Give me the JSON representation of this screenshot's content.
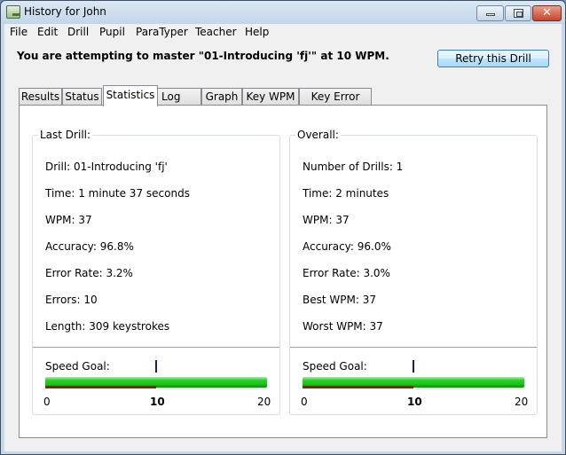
{
  "window": {
    "title": "History for John",
    "controls": {
      "minimize": "minimize",
      "maximize": "maximize",
      "close": "close"
    }
  },
  "menu": [
    "File",
    "Edit",
    "Drill",
    "Pupil",
    "ParaTyper",
    "Teacher",
    "Help"
  ],
  "headline": "You are attempting to master \"01-Introducing 'fj'\" at 10 WPM.",
  "retry_button": "Retry this Drill",
  "tabs": [
    {
      "label": "Results",
      "active": false
    },
    {
      "label": "Status",
      "active": false
    },
    {
      "label": "Statistics",
      "active": true
    },
    {
      "label": "Log",
      "active": false
    },
    {
      "label": "Graph",
      "active": false
    },
    {
      "label": "Key WPM",
      "active": false
    },
    {
      "label": "Key Error Rate",
      "active": false
    }
  ],
  "last_drill": {
    "title": "Last Drill:",
    "stats": [
      "Drill: 01-Introducing 'fj'",
      "Time: 1 minute 37 seconds",
      "WPM: 37",
      "Accuracy: 96.8%",
      "Error Rate: 3.2%",
      "Errors: 10",
      "Length: 309 keystrokes"
    ],
    "speed_goal": {
      "label": "Speed Goal:",
      "min": 0,
      "goal": 10,
      "max": 20,
      "tick_labels": [
        "0",
        "10",
        "20"
      ],
      "achieved_wpm": 37
    }
  },
  "overall": {
    "title": "Overall:",
    "stats": [
      "Number of Drills: 1",
      "Time: 2 minutes",
      "WPM: 37",
      "Accuracy: 96.0%",
      "Error Rate: 3.0%",
      "Best WPM: 37",
      "Worst WPM: 37"
    ],
    "speed_goal": {
      "label": "Speed Goal:",
      "min": 0,
      "goal": 10,
      "max": 20,
      "tick_labels": [
        "0",
        "10",
        "20"
      ],
      "achieved_wpm": 37
    }
  },
  "colors": {
    "progress_green": "#19c019",
    "goal_red": "#9a1a0a",
    "goal_marker": "#1a1a7a"
  }
}
